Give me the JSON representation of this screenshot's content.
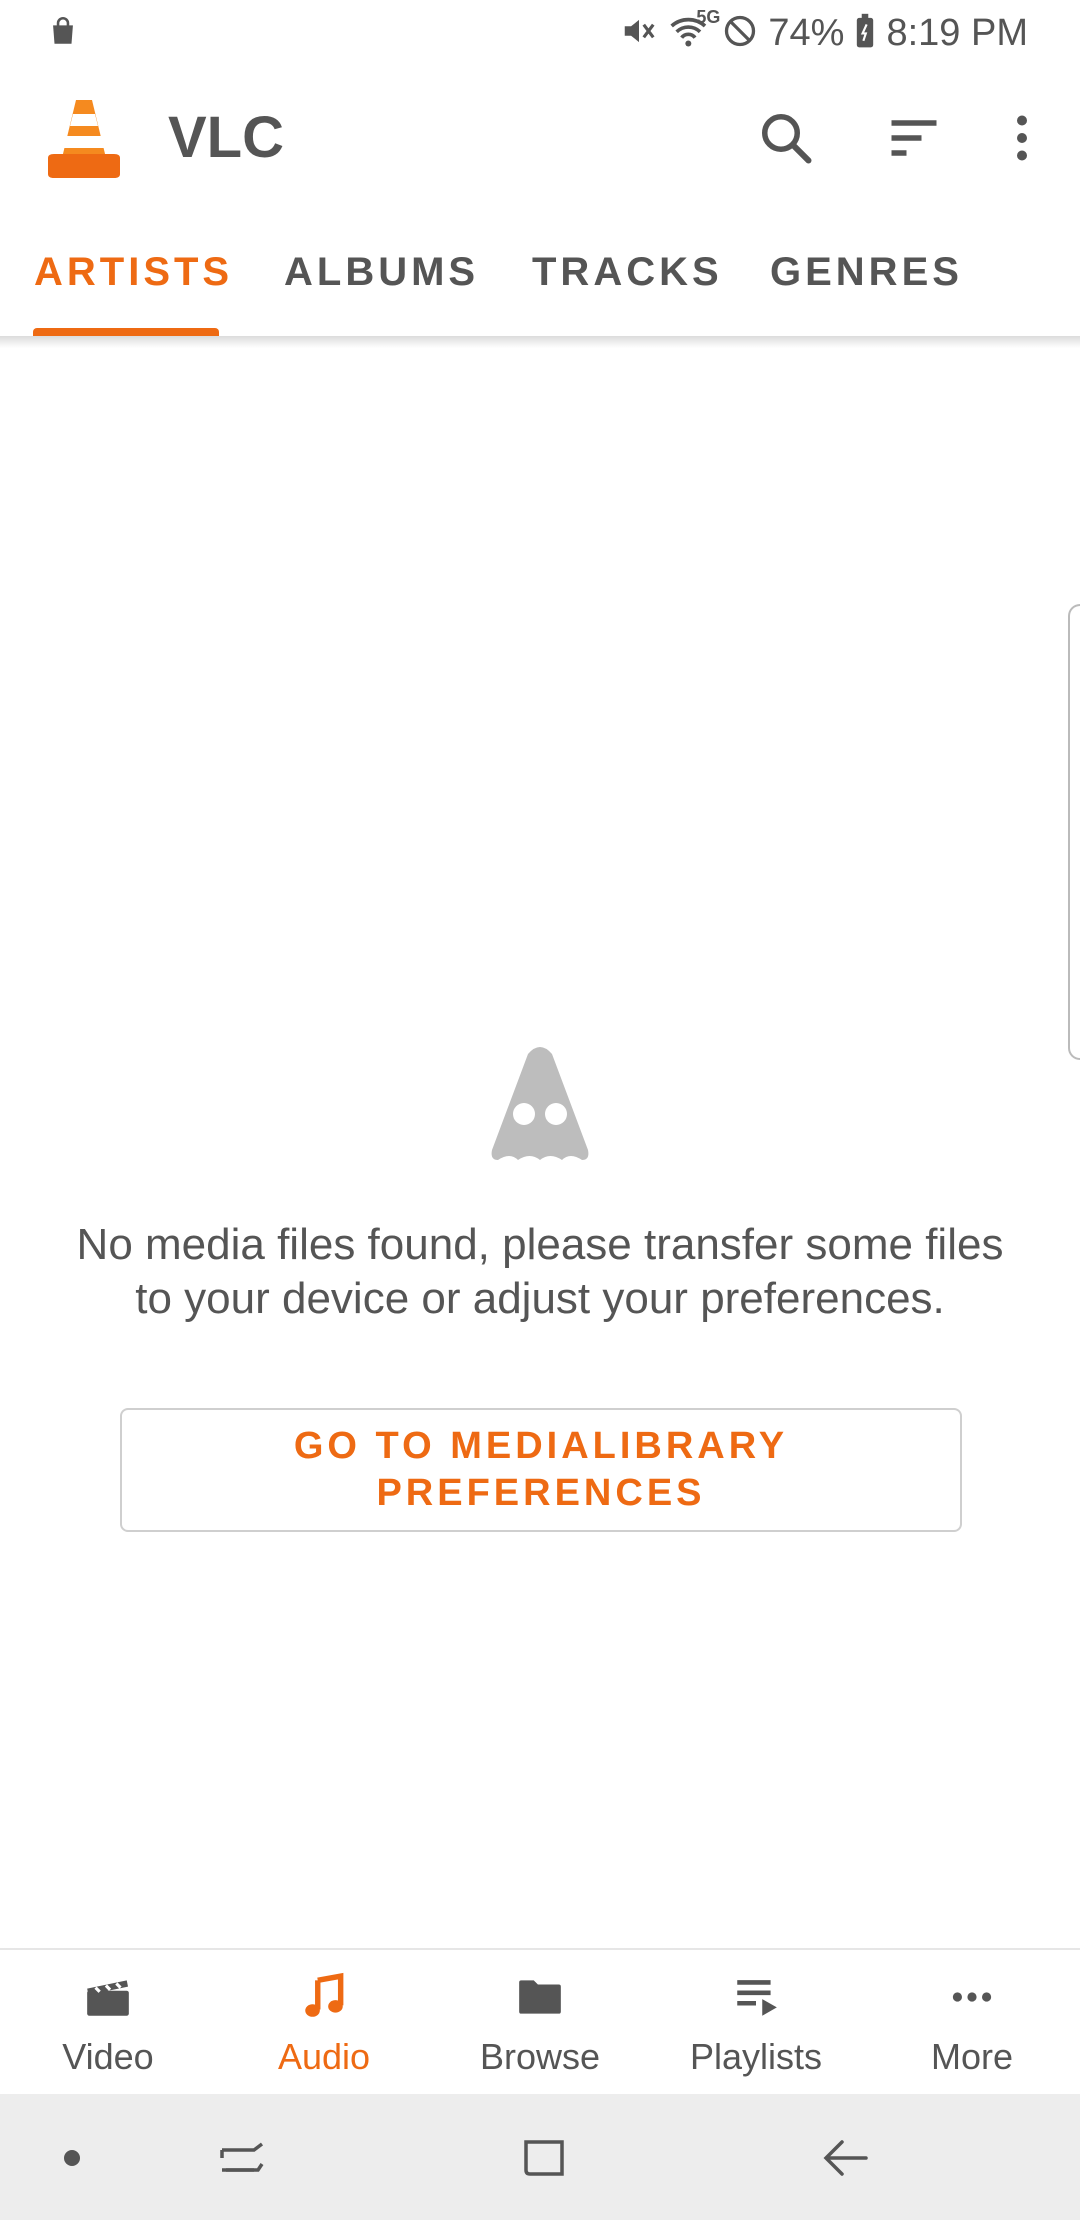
{
  "status_bar": {
    "battery": "74%",
    "time": "8:19 PM",
    "network": "5G"
  },
  "app_bar": {
    "title": "VLC"
  },
  "tabs": [
    {
      "label": "ARTISTS",
      "active": true
    },
    {
      "label": "ALBUMS",
      "active": false
    },
    {
      "label": "TRACKS",
      "active": false
    },
    {
      "label": "GENRES",
      "active": false
    }
  ],
  "empty_state": {
    "message_line1": "No media files found, please transfer some files",
    "message_line2": "to your device or adjust your preferences.",
    "button_line1": "GO TO MEDIALIBRARY",
    "button_line2": "PREFERENCES"
  },
  "bottom_nav": [
    {
      "label": "Video",
      "icon": "clapperboard-icon",
      "active": false
    },
    {
      "label": "Audio",
      "icon": "music-note-icon",
      "active": true
    },
    {
      "label": "Browse",
      "icon": "folder-icon",
      "active": false
    },
    {
      "label": "Playlists",
      "icon": "playlist-icon",
      "active": false
    },
    {
      "label": "More",
      "icon": "more-horizontal-icon",
      "active": false
    }
  ],
  "colors": {
    "accent": "#ee6a13",
    "text": "#555555",
    "ghost_icon": "#bdbdbd",
    "system_nav_bg": "#ededed"
  }
}
